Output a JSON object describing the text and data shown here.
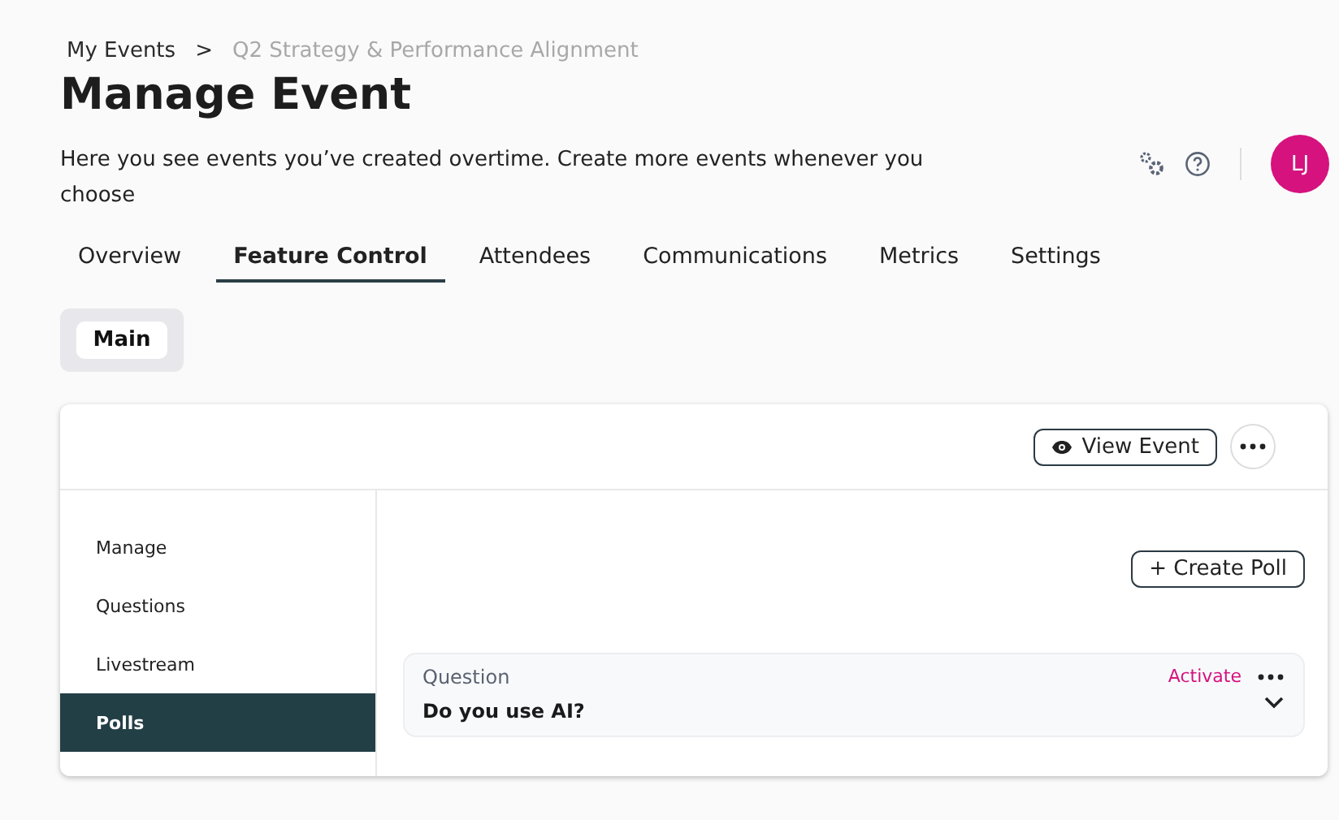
{
  "breadcrumb": [
    {
      "label": "My Events",
      "kind": "link"
    },
    {
      "label": ">",
      "kind": "separator"
    },
    {
      "label": "Q2 Strategy & Performance Alignment",
      "kind": "current"
    }
  ],
  "title": "Manage Event",
  "description": "Here you see events you’ve created overtime. Create more events whenever you choose",
  "user": {
    "initials": "LJ",
    "color": "#d6127f"
  },
  "tabs": [
    {
      "label": "Overview",
      "selected": false
    },
    {
      "label": "Feature Control",
      "selected": true
    },
    {
      "label": "Attendees",
      "selected": false
    },
    {
      "label": "Communications",
      "selected": false
    },
    {
      "label": "Metrics",
      "selected": false
    },
    {
      "label": "Settings",
      "selected": false
    }
  ],
  "sub_tabs": [
    {
      "label": "Main",
      "selected": true
    }
  ],
  "card": {
    "view_button": "View Event",
    "sidebar": [
      {
        "label": "Manage",
        "selected": false
      },
      {
        "label": "Questions",
        "selected": false
      },
      {
        "label": "Livestream",
        "selected": false
      },
      {
        "label": "Polls",
        "selected": true
      }
    ],
    "create_button": "+ Create Poll",
    "polls": [
      {
        "heading": "Question",
        "question": "Do you use AI?",
        "action": "Activate",
        "expanded": false
      }
    ]
  }
}
